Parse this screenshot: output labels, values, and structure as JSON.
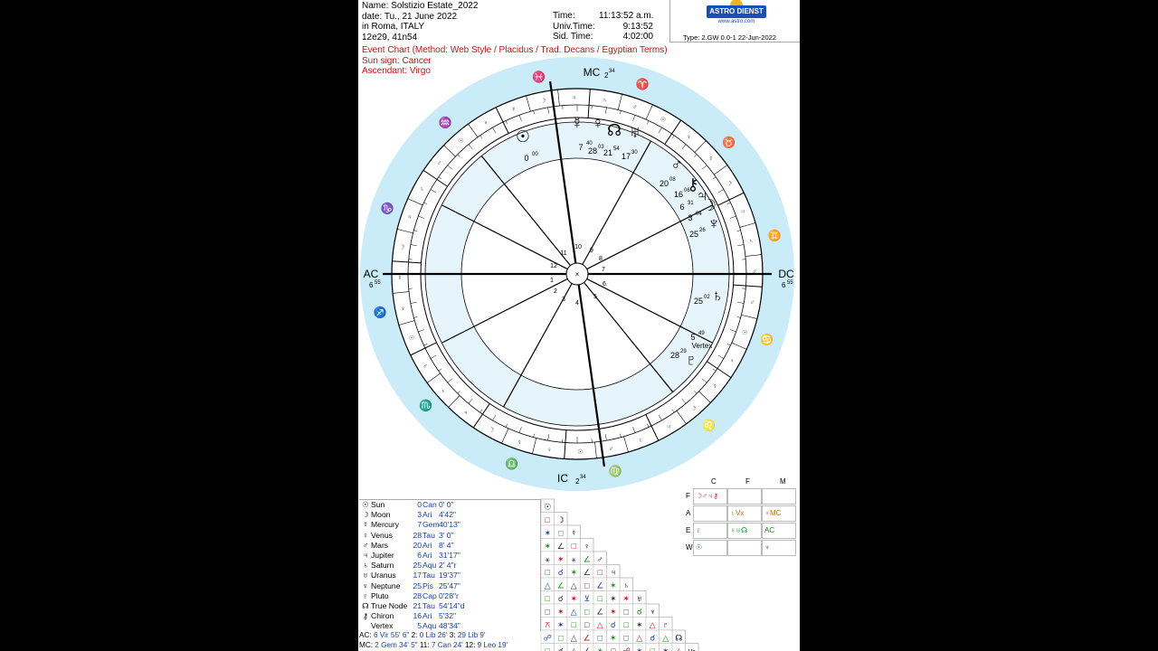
{
  "header": {
    "name_line": "Name: Solstizio Estate_2022",
    "date_line": "date: Tu., 21 June 2022",
    "place_line": "in Roma, ITALY",
    "coords_line": "12e29, 41n54",
    "time_label": "Time:",
    "time_value": "11:13:52 a.m.",
    "ut_label": "Univ.Time:",
    "ut_value": "9:13:52",
    "sid_label": "Sid. Time:",
    "sid_value": "4:02:00",
    "logo_text": "ASTRO DIENST",
    "logo_url": "www.astro.com",
    "type_line": "Type: 2.GW   0.0-1   22-Jun-2022"
  },
  "chart_info": {
    "chart_title": "Event Chart  (Method: Web Style / Placidus / Trad. Decans / Egyptian Terms)",
    "sun_sign": "Sun sign: Cancer",
    "ascendant": "Ascendant: Virgo"
  },
  "angles": {
    "mc": "MC",
    "mc_deg": "2",
    "mc_min": "34",
    "ic": "IC",
    "ic_deg": "2",
    "ic_min": "34",
    "ac": "AC",
    "ac_deg": "6",
    "ac_min": "55",
    "dc": "DC",
    "dc_deg": "6",
    "dc_min": "55"
  },
  "house_numbers": [
    "1",
    "2",
    "3",
    "4",
    "5",
    "6",
    "7",
    "8",
    "9",
    "10",
    "11",
    "12"
  ],
  "wheel_planets": [
    {
      "glyph": "☉",
      "deg": "0",
      "min": "00",
      "color": "#000"
    },
    {
      "glyph": "☿",
      "deg": "7",
      "min": "40",
      "color": "#000"
    },
    {
      "glyph": "♀",
      "deg": "28",
      "min": "03",
      "color": "#000"
    },
    {
      "glyph": "☊",
      "deg": "21",
      "min": "54",
      "color": "#000"
    },
    {
      "glyph": "♅",
      "deg": "17",
      "min": "30",
      "color": "#000"
    },
    {
      "glyph": "♂",
      "deg": "20",
      "min": "08",
      "color": "#000"
    },
    {
      "glyph": "⚷",
      "deg": "16",
      "min": "06",
      "color": "#000"
    },
    {
      "glyph": "♃",
      "deg": "6",
      "min": "31",
      "color": "#000"
    },
    {
      "glyph": "☽",
      "deg": "3",
      "min": "04",
      "color": "#000"
    },
    {
      "glyph": "♆",
      "deg": "25",
      "min": "26",
      "color": "#000"
    },
    {
      "glyph": "♄",
      "deg": "25",
      "min": "02",
      "color": "#000"
    },
    {
      "glyph": "Vertex",
      "deg": "5",
      "min": "49",
      "color": "#000"
    },
    {
      "glyph": "♇",
      "deg": "28",
      "min": "29",
      "color": "#000"
    }
  ],
  "planets": [
    {
      "glyph": "☉",
      "name": "Sun",
      "deg": "0",
      "sign": "Can",
      "min": "0' 0\""
    },
    {
      "glyph": "☽",
      "name": "Moon",
      "deg": "3",
      "sign": "Ari",
      "min": "4'42\""
    },
    {
      "glyph": "☿",
      "name": "Mercury",
      "deg": "7",
      "sign": "Gem",
      "min": "40'13\""
    },
    {
      "glyph": "♀",
      "name": "Venus",
      "deg": "28",
      "sign": "Tau",
      "min": "3' 0\""
    },
    {
      "glyph": "♂",
      "name": "Mars",
      "deg": "20",
      "sign": "Ari",
      "min": "8' 4\""
    },
    {
      "glyph": "♃",
      "name": "Jupiter",
      "deg": "6",
      "sign": "Ari",
      "min": "31'17\""
    },
    {
      "glyph": "♄",
      "name": "Saturn",
      "deg": "25",
      "sign": "Aqu",
      "min": "2' 4\"r"
    },
    {
      "glyph": "♅",
      "name": "Uranus",
      "deg": "17",
      "sign": "Tau",
      "min": "19'37\""
    },
    {
      "glyph": "♆",
      "name": "Neptune",
      "deg": "25",
      "sign": "Pis",
      "min": "25'47\""
    },
    {
      "glyph": "♇",
      "name": "Pluto",
      "deg": "28",
      "sign": "Cap",
      "min": "0'28\"r"
    },
    {
      "glyph": "☊",
      "name": "True Node",
      "deg": "21",
      "sign": "Tau",
      "min": "54'14\"d"
    },
    {
      "glyph": "⚷",
      "name": "Chiron",
      "deg": "16",
      "sign": "Ari",
      "min": "5'32\""
    },
    {
      "glyph": "",
      "name": "Vertex",
      "deg": "5",
      "sign": "Aqu",
      "min": "48'34\""
    }
  ],
  "house_cusps": {
    "row1": {
      "l1": "AC:",
      "v1": "6 Vir 55' 6\"",
      "l2": "2:",
      "v2": "0 Lib 26'",
      "l3": "3:",
      "v3": "29 Lib  9'"
    },
    "row2": {
      "l1": "MC:",
      "v1": "2 Gem 34' 5\"",
      "l2": "11:",
      "v2": "7 Can 24'",
      "l3": "12:",
      "v3": "9 Leo 19'"
    }
  },
  "aspect_grid": {
    "labels": [
      "☉",
      "☽",
      "☿",
      "♀",
      "♂",
      "♃",
      "♄",
      "♅",
      "♆",
      "♇",
      "☊",
      "Ve"
    ],
    "symbols": [
      [
        "□"
      ],
      [
        "✶",
        "□"
      ],
      [
        "✶",
        "∠",
        "□"
      ],
      [
        "⚹",
        "✶",
        "⚹",
        "∠"
      ],
      [
        "□",
        "☌",
        "✶",
        "∠",
        "□"
      ],
      [
        "△",
        "∠",
        "△",
        "□",
        "∠",
        "✶"
      ],
      [
        "□",
        "☌",
        "✶",
        "⊻",
        "□",
        "✶",
        "✶"
      ],
      [
        "□",
        "✶",
        "△",
        "□",
        "∠",
        "✶",
        "□",
        "☌"
      ],
      [
        "⚻",
        "✶",
        "□",
        "□",
        "△",
        "☌",
        "□",
        "✶",
        "△"
      ],
      [
        "☍",
        "□",
        "△",
        "∠",
        "□",
        "✶",
        "□",
        "△",
        "☌",
        "△"
      ],
      [
        "□",
        "☌",
        "△",
        "∠",
        "✶",
        "□",
        "☍",
        "✶",
        "□",
        "✶",
        "△"
      ]
    ]
  },
  "elements": {
    "col_headers": [
      "C",
      "F",
      "M"
    ],
    "row_headers": [
      "F",
      "A",
      "E",
      "W"
    ],
    "cells": [
      [
        "☽♂♃⚷",
        "",
        ""
      ],
      [
        "",
        "♄Vx",
        "♆MC"
      ],
      [
        "♇",
        "♀♅☊",
        "AC"
      ],
      [
        "☉",
        "",
        "♆"
      ]
    ],
    "colors": {
      "fire": "#d01010",
      "air": "#c07000",
      "earth": "#109010",
      "water": "#1a3faa"
    }
  },
  "colors": {
    "outer_ring": "#c9ecf8",
    "inner_disc": "#e6f5fb",
    "line": "#000000",
    "red": "#d01010",
    "blue": "#1a3faa"
  }
}
